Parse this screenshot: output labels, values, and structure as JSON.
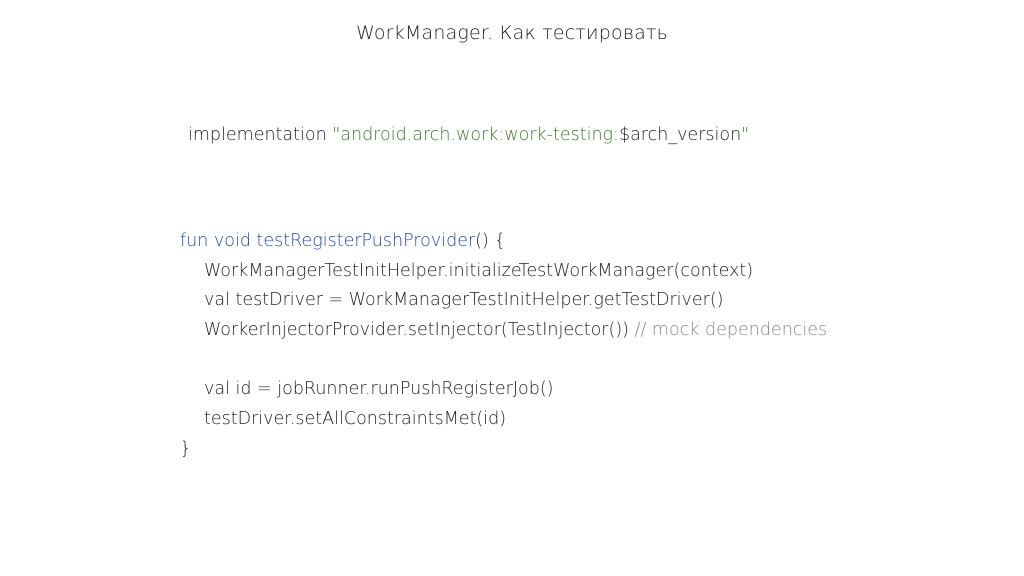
{
  "slide": {
    "title": "WorkManager. Как тестировать"
  },
  "dependency": {
    "prefix": "implementation ",
    "string_open": "\"android.arch.work:work-testing:",
    "variable": "$arch_version",
    "string_close": "\""
  },
  "code": {
    "line1_keyword": "fun void testRegisterPushProvider",
    "line1_rest": "() {",
    "line2": "WorkManagerTestInitHelper.initializeTestWorkManager(context)",
    "line3": "val testDriver = WorkManagerTestInitHelper.getTestDriver()",
    "line4_code": "WorkerInjectorProvider.setInjector(TestInjector()) ",
    "line4_comment": "// mock dependencies",
    "line6": "val id = jobRunner.runPushRegisterJob()",
    "line7": "testDriver.setAllConstraintsMet(id)",
    "line8": "}"
  },
  "colors": {
    "keyword": "#2b45a8",
    "string": "#3e7a2e",
    "comment": "#8a8a8a",
    "text": "#1f1f1f"
  }
}
